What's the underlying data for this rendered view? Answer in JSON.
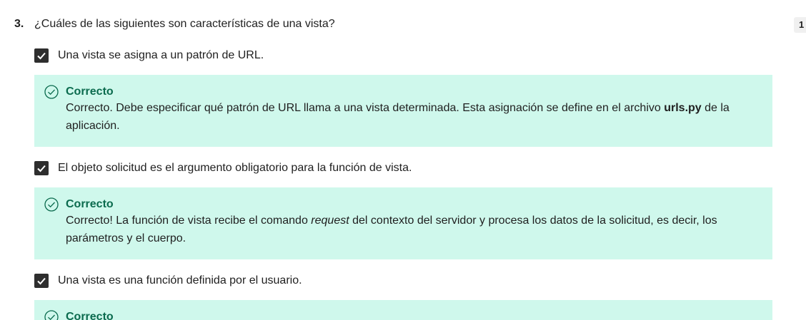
{
  "question": {
    "number": "3.",
    "text": "¿Cuáles de las siguientes son características de una vista?",
    "points_badge": "1"
  },
  "options": [
    {
      "label": "Una vista se asigna a un patrón de URL.",
      "checked": true,
      "feedback": {
        "title": "Correcto",
        "text_before": "Correcto. Debe especificar qué patrón de URL llama a una vista determinada. Esta asignación se define en el archivo ",
        "emphasis": "urls.py",
        "text_after": " de la aplicación."
      }
    },
    {
      "label": "El objeto solicitud es el argumento obligatorio para la función de vista.",
      "checked": true,
      "feedback": {
        "title": "Correcto",
        "text_before": "Correcto! La función de vista recibe el comando ",
        "emphasis": "request",
        "text_after": " del contexto del servidor y procesa los datos de la solicitud, es decir, los parámetros y el cuerpo."
      }
    },
    {
      "label": "Una vista es una función definida por el usuario.",
      "checked": true,
      "feedback": {
        "title": "Correcto"
      }
    }
  ],
  "colors": {
    "feedback_bg": "#cff8ec",
    "correct_green": "#0b6b4e",
    "checkbox": "#2e2e2e"
  },
  "icons": {
    "checkbox": "checkmark-icon",
    "feedback": "check-circle-icon"
  }
}
